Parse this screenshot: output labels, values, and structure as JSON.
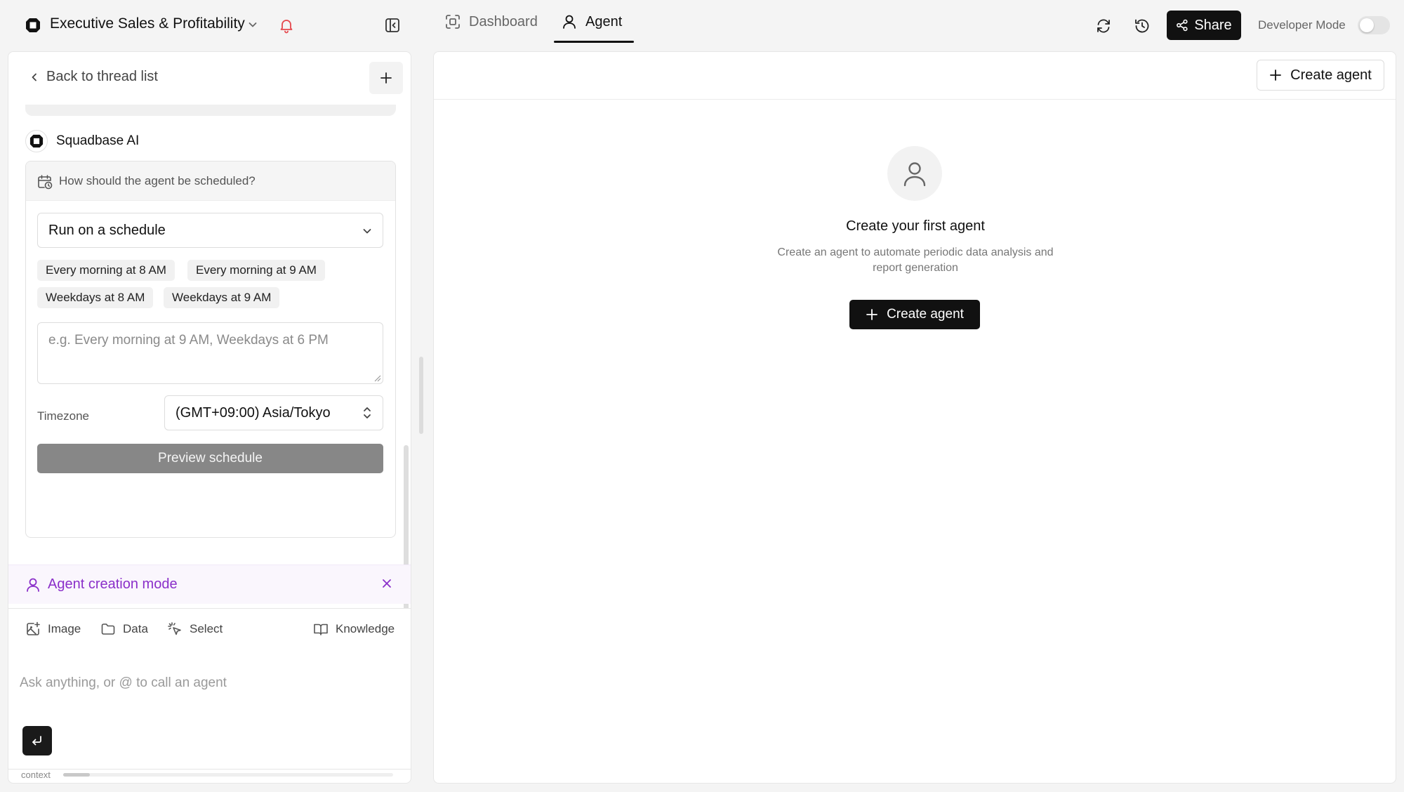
{
  "header": {
    "app_title": "Executive Sales & Profitability",
    "tabs": [
      {
        "label": "Dashboard",
        "icon": "frame-icon",
        "active": false
      },
      {
        "label": "Agent",
        "icon": "user-icon",
        "active": true
      }
    ],
    "share_label": "Share",
    "developer_mode_label": "Developer Mode",
    "developer_mode_on": false
  },
  "thread": {
    "back_label": "Back to thread list",
    "assistant_name": "Squadbase AI",
    "schedule_card": {
      "question": "How should the agent be scheduled?",
      "mode_value": "Run on a schedule",
      "presets": [
        "Every morning at 8 AM",
        "Every morning at 9 AM",
        "Weekdays at 8 AM",
        "Weekdays at 9 AM"
      ],
      "custom_placeholder": "e.g. Every morning at 9 AM, Weekdays at 6 PM",
      "timezone_label": "Timezone",
      "timezone_value": "(GMT+09:00) Asia/Tokyo",
      "preview_label": "Preview schedule"
    }
  },
  "mode_bar": {
    "label": "Agent creation mode",
    "accent_color": "#8a2fc9"
  },
  "composer": {
    "tools": [
      "Image",
      "Data",
      "Select"
    ],
    "knowledge_label": "Knowledge",
    "placeholder": "Ask anything, or @ to call an agent",
    "context_label": "context",
    "context_usage": 0.08
  },
  "agents_panel": {
    "create_button_label": "Create agent",
    "empty_title": "Create your first agent",
    "empty_description": "Create an agent to automate periodic data analysis and report generation",
    "empty_button_label": "Create agent"
  }
}
